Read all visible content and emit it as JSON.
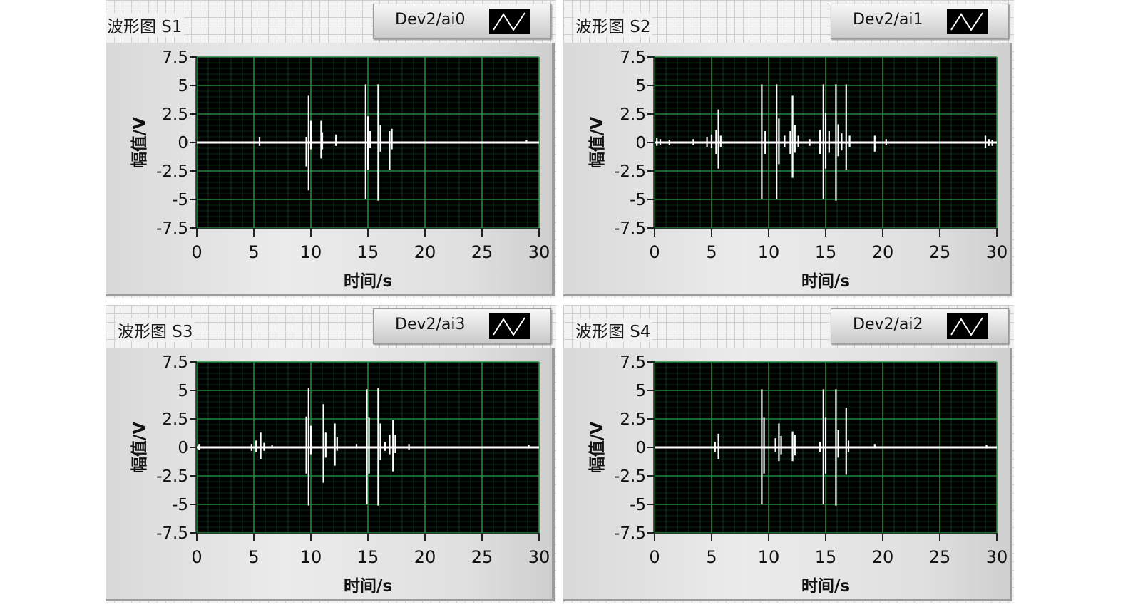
{
  "colors": {
    "plot_bg": "#000000",
    "grid": "#1f8a3a",
    "trace": "#ffffff"
  },
  "panels": [
    {
      "id": "s1",
      "title": "波形图 S1",
      "channel": "Dev2/ai0",
      "chart_data": {
        "type": "line",
        "xlabel": "时间/s",
        "ylabel": "幅值/V",
        "xlim": [
          0,
          30
        ],
        "ylim": [
          -7.5,
          7.5
        ],
        "xticks": [
          "0",
          "5",
          "10",
          "15",
          "20",
          "25",
          "30"
        ],
        "yticks": [
          "7.5",
          "5",
          "2.5",
          "0",
          "-2.5",
          "-5",
          "-7.5"
        ],
        "grid": true,
        "baseline": 0,
        "spikes": [
          {
            "x": 5.5,
            "max": 0.5,
            "min": -0.3
          },
          {
            "x": 9.6,
            "max": 0.5,
            "min": -2.1
          },
          {
            "x": 9.8,
            "max": 4.1,
            "min": -4.2
          },
          {
            "x": 10.0,
            "max": 1.9,
            "min": -0.6
          },
          {
            "x": 10.9,
            "max": 1.9,
            "min": -1.4
          },
          {
            "x": 11.0,
            "max": 0.9,
            "min": -0.6
          },
          {
            "x": 12.2,
            "max": 0.7,
            "min": -0.3
          },
          {
            "x": 14.8,
            "max": 5.1,
            "min": -5.0
          },
          {
            "x": 15.0,
            "max": 2.3,
            "min": -2.4
          },
          {
            "x": 15.2,
            "max": 1.0,
            "min": -0.5
          },
          {
            "x": 15.9,
            "max": 5.1,
            "min": -5.1
          },
          {
            "x": 16.1,
            "max": 1.5,
            "min": -0.8
          },
          {
            "x": 16.9,
            "max": 1.0,
            "min": -2.4
          },
          {
            "x": 17.1,
            "max": 1.2,
            "min": -0.6
          },
          {
            "x": 28.9,
            "max": 0.2,
            "min": -0.1
          }
        ]
      }
    },
    {
      "id": "s2",
      "title": "波形图 S2",
      "channel": "Dev2/ai1",
      "chart_data": {
        "type": "line",
        "xlabel": "时间/s",
        "ylabel": "幅值/V",
        "xlim": [
          0,
          30
        ],
        "ylim": [
          -7.5,
          7.5
        ],
        "xticks": [
          "0",
          "5",
          "10",
          "15",
          "20",
          "25",
          "30"
        ],
        "yticks": [
          "7.5",
          "5",
          "2.5",
          "0",
          "-2.5",
          "-5",
          "-7.5"
        ],
        "grid": true,
        "baseline": 0,
        "spikes": [
          {
            "x": 0.2,
            "max": 0.4,
            "min": -0.3
          },
          {
            "x": 0.5,
            "max": 0.3,
            "min": -0.2
          },
          {
            "x": 1.3,
            "max": 0.2,
            "min": -0.2
          },
          {
            "x": 3.4,
            "max": 0.3,
            "min": -0.2
          },
          {
            "x": 4.6,
            "max": 0.5,
            "min": -0.4
          },
          {
            "x": 5.0,
            "max": 0.7,
            "min": -0.5
          },
          {
            "x": 5.4,
            "max": 1.1,
            "min": -1.0
          },
          {
            "x": 5.6,
            "max": 2.9,
            "min": -2.3
          },
          {
            "x": 5.8,
            "max": 0.6,
            "min": -0.4
          },
          {
            "x": 9.4,
            "max": 5.1,
            "min": -5.0
          },
          {
            "x": 9.7,
            "max": 1.0,
            "min": -1.0
          },
          {
            "x": 10.7,
            "max": 5.1,
            "min": -5.0
          },
          {
            "x": 10.9,
            "max": 2.1,
            "min": -1.9
          },
          {
            "x": 11.4,
            "max": 0.6,
            "min": -0.4
          },
          {
            "x": 11.9,
            "max": 1.0,
            "min": -1.0
          },
          {
            "x": 12.1,
            "max": 4.1,
            "min": -3.1
          },
          {
            "x": 12.3,
            "max": 1.5,
            "min": -0.9
          },
          {
            "x": 12.6,
            "max": 0.6,
            "min": -0.4
          },
          {
            "x": 13.6,
            "max": 0.3,
            "min": -0.3
          },
          {
            "x": 14.5,
            "max": 1.1,
            "min": -1.0
          },
          {
            "x": 14.8,
            "max": 5.1,
            "min": -5.0
          },
          {
            "x": 15.0,
            "max": 2.6,
            "min": -2.3
          },
          {
            "x": 15.3,
            "max": 1.0,
            "min": -0.9
          },
          {
            "x": 15.9,
            "max": 5.1,
            "min": -5.1
          },
          {
            "x": 16.1,
            "max": 1.6,
            "min": -1.2
          },
          {
            "x": 16.4,
            "max": 0.8,
            "min": -0.7
          },
          {
            "x": 16.8,
            "max": 5.1,
            "min": -2.4
          },
          {
            "x": 17.1,
            "max": 0.6,
            "min": -0.4
          },
          {
            "x": 19.3,
            "max": 0.6,
            "min": -0.8
          },
          {
            "x": 20.3,
            "max": 0.3,
            "min": -0.2
          },
          {
            "x": 29.0,
            "max": 0.6,
            "min": -0.5
          },
          {
            "x": 29.3,
            "max": 0.3,
            "min": -0.3
          },
          {
            "x": 29.6,
            "max": 0.2,
            "min": -0.3
          }
        ]
      }
    },
    {
      "id": "s3",
      "title": "波形图 S3",
      "channel": "Dev2/ai3",
      "chart_data": {
        "type": "line",
        "xlabel": "时间/s",
        "ylabel": "幅值/V",
        "xlim": [
          0,
          30
        ],
        "ylim": [
          -7.5,
          7.5
        ],
        "xticks": [
          "0",
          "5",
          "10",
          "15",
          "20",
          "25",
          "30"
        ],
        "yticks": [
          "7.5",
          "5",
          "2.5",
          "0",
          "-2.5",
          "-5",
          "-7.5"
        ],
        "grid": true,
        "baseline": 0,
        "spikes": [
          {
            "x": 0.2,
            "max": 0.3,
            "min": -0.2
          },
          {
            "x": 4.8,
            "max": 0.3,
            "min": -0.3
          },
          {
            "x": 5.2,
            "max": 0.6,
            "min": -0.4
          },
          {
            "x": 5.6,
            "max": 1.3,
            "min": -1.0
          },
          {
            "x": 5.9,
            "max": 0.4,
            "min": -0.3
          },
          {
            "x": 6.6,
            "max": 0.2,
            "min": -0.1
          },
          {
            "x": 9.6,
            "max": 2.7,
            "min": -2.3
          },
          {
            "x": 9.8,
            "max": 5.2,
            "min": -5.1
          },
          {
            "x": 10.0,
            "max": 1.9,
            "min": -0.6
          },
          {
            "x": 11.1,
            "max": 3.8,
            "min": -3.1
          },
          {
            "x": 11.3,
            "max": 1.3,
            "min": -0.9
          },
          {
            "x": 12.1,
            "max": 2.1,
            "min": -1.6
          },
          {
            "x": 12.3,
            "max": 0.9,
            "min": -0.3
          },
          {
            "x": 14.0,
            "max": 0.3,
            "min": -0.1
          },
          {
            "x": 14.9,
            "max": 5.1,
            "min": -5.0
          },
          {
            "x": 15.1,
            "max": 2.6,
            "min": -2.3
          },
          {
            "x": 15.9,
            "max": 5.2,
            "min": -5.1
          },
          {
            "x": 16.1,
            "max": 2.1,
            "min": -1.1
          },
          {
            "x": 16.5,
            "max": 0.5,
            "min": -0.3
          },
          {
            "x": 16.9,
            "max": 1.1,
            "min": -0.6
          },
          {
            "x": 17.2,
            "max": 2.4,
            "min": -2.1
          },
          {
            "x": 17.4,
            "max": 1.1,
            "min": -0.5
          },
          {
            "x": 18.6,
            "max": 0.3,
            "min": -0.2
          },
          {
            "x": 29.1,
            "max": 0.2,
            "min": -0.1
          }
        ]
      }
    },
    {
      "id": "s4",
      "title": "波形图 S4",
      "channel": "Dev2/ai2",
      "chart_data": {
        "type": "line",
        "xlabel": "时间/s",
        "ylabel": "幅值/V",
        "xlim": [
          0,
          30
        ],
        "ylim": [
          -7.5,
          7.5
        ],
        "xticks": [
          "0",
          "5",
          "10",
          "15",
          "20",
          "25",
          "30"
        ],
        "yticks": [
          "7.5",
          "5",
          "2.5",
          "0",
          "-2.5",
          "-5",
          "-7.5"
        ],
        "grid": true,
        "baseline": 0,
        "spikes": [
          {
            "x": 5.3,
            "max": 0.5,
            "min": -0.4
          },
          {
            "x": 5.6,
            "max": 1.2,
            "min": -1.0
          },
          {
            "x": 9.4,
            "max": 5.1,
            "min": -5.0
          },
          {
            "x": 9.6,
            "max": 2.6,
            "min": -2.3
          },
          {
            "x": 10.6,
            "max": 0.8,
            "min": -0.4
          },
          {
            "x": 10.9,
            "max": 2.1,
            "min": -1.2
          },
          {
            "x": 11.1,
            "max": 1.0,
            "min": -0.6
          },
          {
            "x": 12.1,
            "max": 1.4,
            "min": -1.2
          },
          {
            "x": 12.3,
            "max": 1.1,
            "min": -0.7
          },
          {
            "x": 14.5,
            "max": 0.5,
            "min": -0.4
          },
          {
            "x": 14.8,
            "max": 5.1,
            "min": -5.0
          },
          {
            "x": 15.0,
            "max": 2.6,
            "min": -2.3
          },
          {
            "x": 15.9,
            "max": 5.1,
            "min": -5.1
          },
          {
            "x": 16.1,
            "max": 1.5,
            "min": -0.9
          },
          {
            "x": 16.8,
            "max": 3.5,
            "min": -2.4
          },
          {
            "x": 17.0,
            "max": 0.6,
            "min": -0.4
          },
          {
            "x": 19.3,
            "max": 0.3,
            "min": -0.1
          },
          {
            "x": 29.1,
            "max": 0.2,
            "min": -0.1
          }
        ]
      }
    }
  ]
}
